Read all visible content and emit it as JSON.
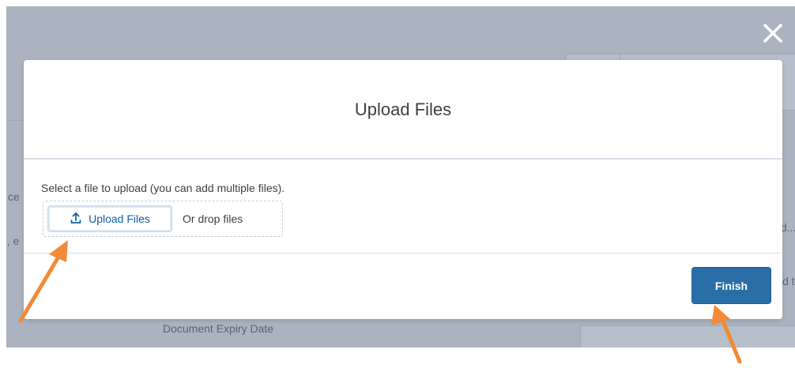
{
  "modal": {
    "title": "Upload Files",
    "hint": "Select a file to upload (you can add multiple files).",
    "upload_button_label": "Upload Files",
    "drop_label": "Or drop files",
    "finish_label": "Finish"
  },
  "background": {
    "field_label": "Document Expiry Date",
    "frag_left_1": "ce",
    "frag_left_2": "', e",
    "frag_right_1": "d...",
    "frag_right_2": "d t"
  },
  "colors": {
    "overlay": "#aab3bf",
    "finish_button": "#2a6ea8",
    "link_blue": "#0f5ea8",
    "annotation_arrow": "#f28a38"
  },
  "icons": {
    "close": "close-icon",
    "upload": "upload-icon",
    "arrow_annotation": "arrow-annotation"
  }
}
